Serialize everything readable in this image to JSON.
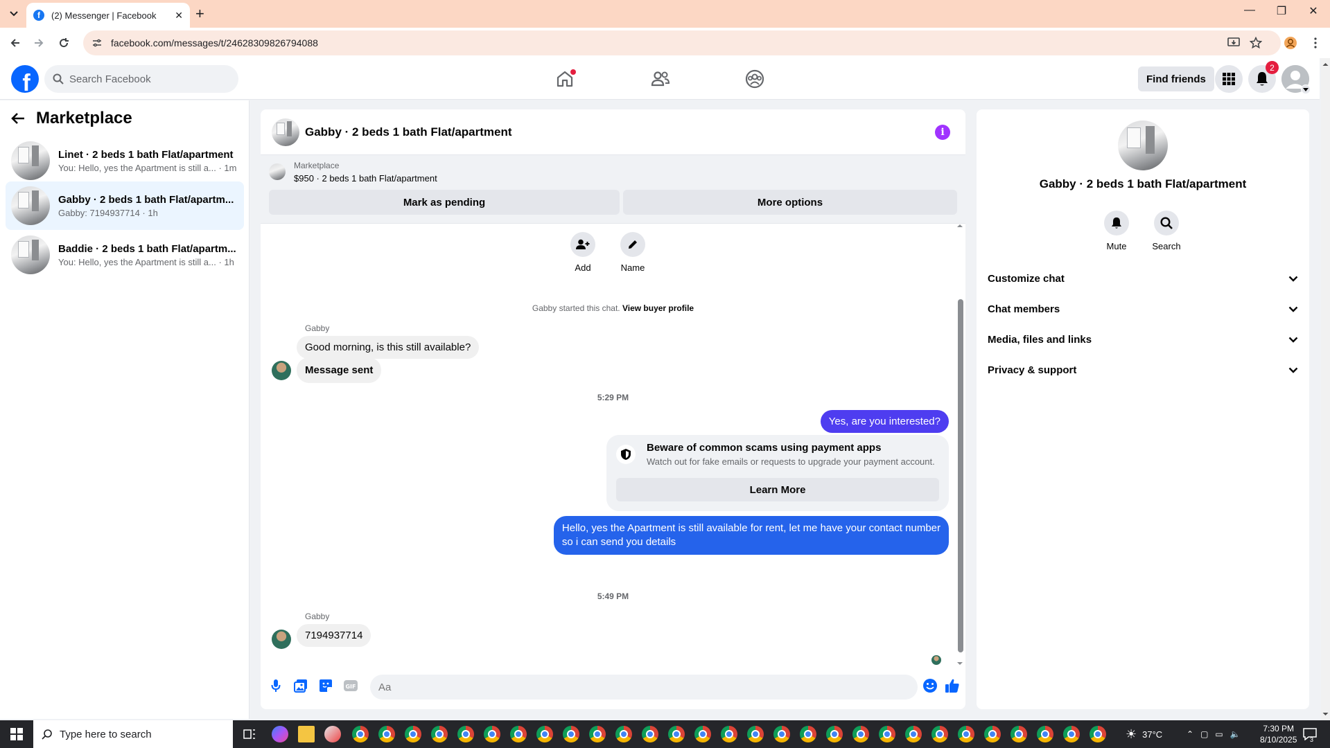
{
  "browser": {
    "tab_title": "(2) Messenger | Facebook",
    "url": "facebook.com/messages/t/24628309826794088"
  },
  "fb": {
    "search_placeholder": "Search Facebook",
    "find_friends": "Find friends",
    "notifications_count": "2"
  },
  "sidebar": {
    "title": "Marketplace",
    "conversations": [
      {
        "name": "Linet · 2 beds 1 bath Flat/apartment",
        "preview": "You: Hello, yes the Apartment is still a... · 1m"
      },
      {
        "name": "Gabby · 2 beds 1 bath Flat/apartm...",
        "preview": "Gabby: 7194937714 · 1h"
      },
      {
        "name": "Baddie · 2 beds 1 bath Flat/apartm...",
        "preview": "You: Hello, yes the Apartment is still a... · 1h"
      }
    ]
  },
  "chat": {
    "title": "Gabby · 2 beds 1 bath Flat/apartment",
    "marketplace_label": "Marketplace",
    "listing": "$950 · 2 beds 1 bath Flat/apartment",
    "mark_pending": "Mark as pending",
    "more_options": "More options",
    "actions": {
      "add": "Add",
      "name": "Name"
    },
    "started_text": "Gabby started this chat.",
    "view_profile": "View buyer profile",
    "sender1": "Gabby",
    "msg1": "Good morning, is this still available?",
    "msg2": "Message sent",
    "ts1": "5:29 PM",
    "out1": "Yes, are you interested?",
    "scam_title": "Beware of common scams using payment apps",
    "scam_text": "Watch out for fake emails or requests to upgrade your payment account.",
    "learn_more": "Learn More",
    "out2_line1": "Hello, yes the Apartment is still available for rent, let me have your contact number",
    "out2_line2": "so i can send you details",
    "ts2": "5:49 PM",
    "sender2": "Gabby",
    "msg3": "7194937714",
    "composer_placeholder": "Aa"
  },
  "details": {
    "name": "Gabby · 2 beds 1 bath Flat/apartment",
    "mute": "Mute",
    "search": "Search",
    "rows": [
      "Customize chat",
      "Chat members",
      "Media, files and links",
      "Privacy & support"
    ]
  },
  "taskbar": {
    "search_placeholder": "Type here to search",
    "temperature": "37°C",
    "time": "7:30 PM",
    "date": "8/10/2025",
    "notif_count": "3"
  },
  "colors": {
    "fb_blue": "#0866ff",
    "bubble_purple": "#4e3df0",
    "bubble_blue": "#2563eb",
    "info_purple": "#a033ff",
    "tab_strip": "#fcd7c4"
  }
}
